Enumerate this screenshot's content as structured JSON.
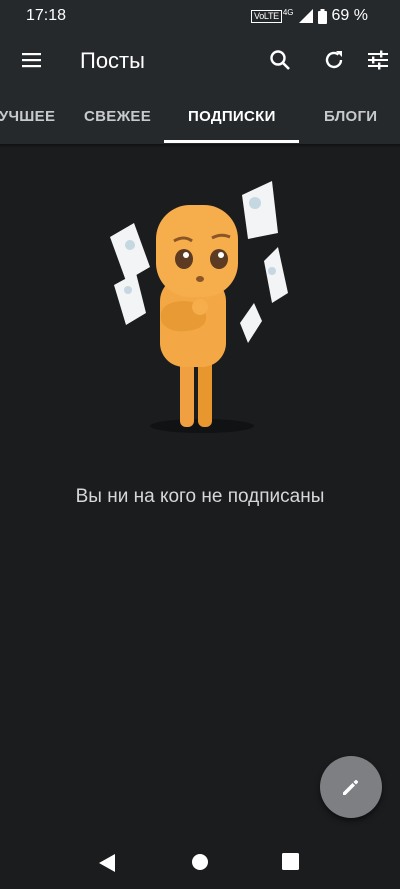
{
  "status": {
    "time": "17:18",
    "volte": "VoLTE",
    "network": "4G",
    "battery": "69 %"
  },
  "toolbar": {
    "title": "Посты",
    "icons": [
      "menu-icon",
      "search-icon",
      "refresh-icon",
      "filter-icon"
    ]
  },
  "tabs": [
    {
      "label": "ЛУЧШЕЕ"
    },
    {
      "label": "СВЕЖЕЕ"
    },
    {
      "label": "ПОДПИСКИ",
      "active": true
    },
    {
      "label": "БЛОГИ"
    }
  ],
  "empty_state": {
    "message": "Вы ни на кого не подписаны"
  },
  "fab": {
    "icon": "pencil-icon"
  },
  "colors": {
    "bar_background": "#25292c",
    "page_background": "#1b1c1e",
    "fab": "#7d7f82",
    "mascot": "#f5a94a"
  }
}
